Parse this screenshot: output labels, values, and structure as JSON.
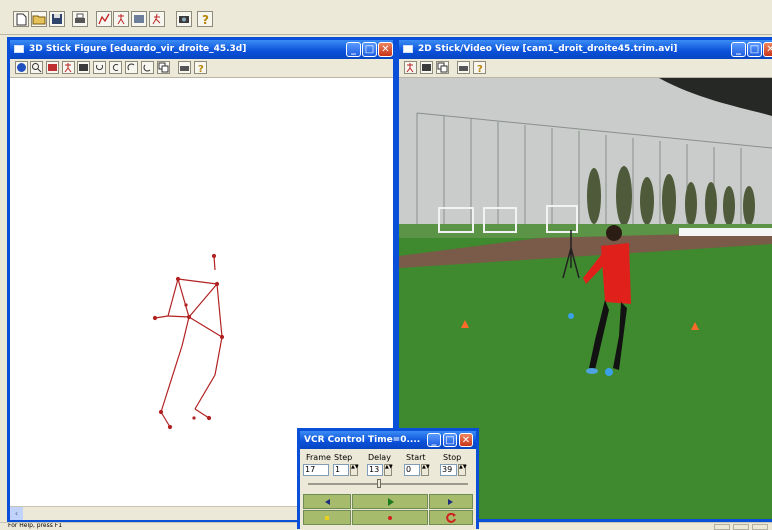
{
  "main_toolbar": {
    "icons": [
      "new-icon",
      "open-icon",
      "save-icon",
      "print-icon",
      "chart-icon",
      "figure-icon",
      "video-icon",
      "run-figure-icon",
      "camera-icon",
      "help-icon"
    ]
  },
  "stick_window": {
    "title": "3D Stick Figure  [eduardo_vir_droite_45.3d]",
    "toolbar_icons": [
      "globe-icon",
      "zoom-icon",
      "chart-icon",
      "figure-icon",
      "video-icon",
      "rotate-x-icon",
      "rotate-y-icon",
      "rotate-z-icon",
      "rotate-back-icon",
      "copy-icon",
      "print-icon",
      "help-icon"
    ],
    "figure_color": "#b22222"
  },
  "video_window": {
    "title": "2D Stick/Video View  [cam1_droit_droite45.trim.avi]",
    "toolbar_icons": [
      "figure-icon",
      "video-icon",
      "copy-icon",
      "print-icon",
      "help-icon"
    ]
  },
  "vcr": {
    "title": "VCR Control   Time=0....",
    "labels": {
      "frame": "Frame",
      "step": "Step",
      "delay": "Delay",
      "start": "Start",
      "stop": "Stop"
    },
    "values": {
      "frame": "17",
      "step": "1",
      "delay": "13",
      "start": "0",
      "stop": "39"
    }
  },
  "status_bar": {
    "text": "For Help, press F1"
  },
  "colors": {
    "title_blue": "#0a50d8",
    "close_red": "#d64b28",
    "grass": "#3f8a2e",
    "sky": "#c8ccc8"
  }
}
